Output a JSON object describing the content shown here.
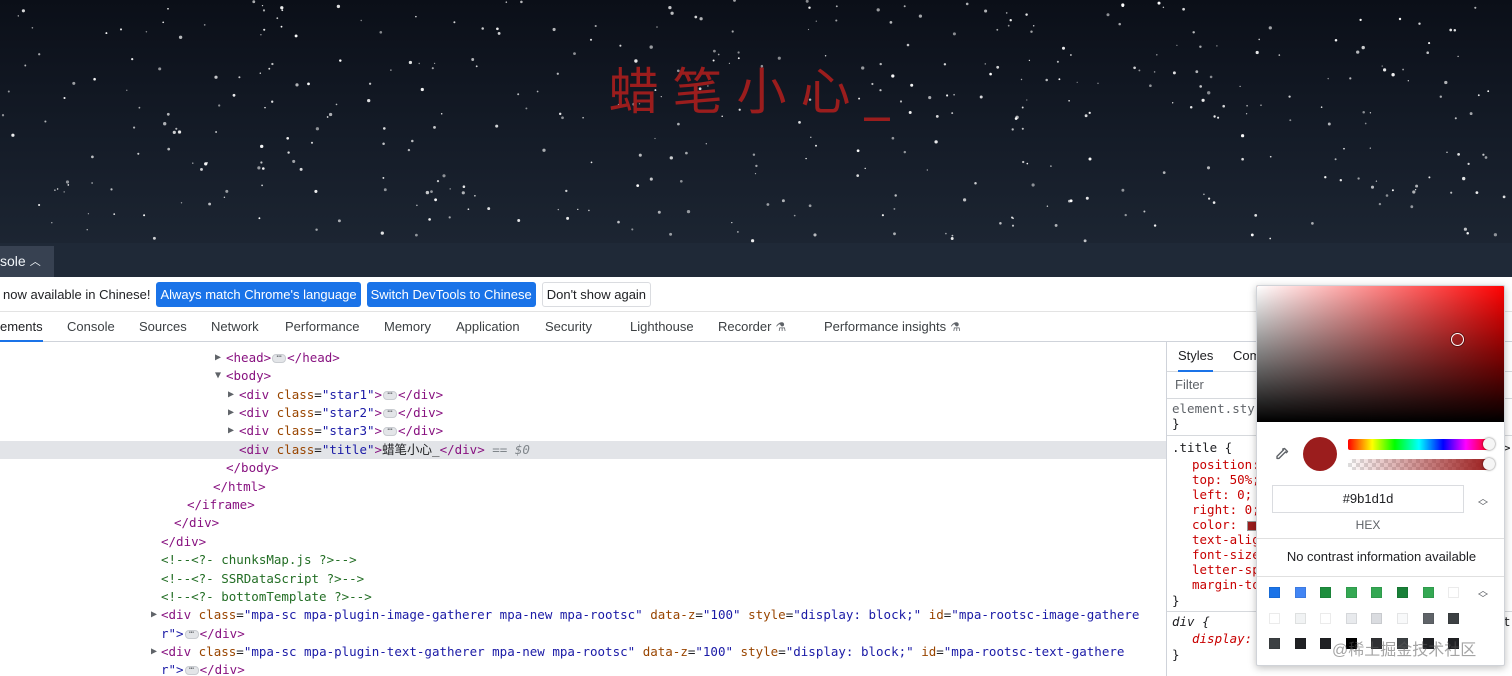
{
  "preview": {
    "title": "蜡笔小心_",
    "title_color": "#9b1d1d"
  },
  "drawer": {
    "tab_label": "sole"
  },
  "infobar": {
    "message": "now available in Chinese!",
    "btn_match": "Always match Chrome's language",
    "btn_switch": "Switch DevTools to Chinese",
    "btn_dismiss": "Don't show again"
  },
  "tabs": [
    "ements",
    "Console",
    "Sources",
    "Network",
    "Performance",
    "Memory",
    "Application",
    "Security",
    "Lighthouse",
    "Recorder",
    "Performance insights"
  ],
  "dom": {
    "head": [
      "<head>",
      "</head>"
    ],
    "body_open": "<body>",
    "div": "div",
    "class": "class",
    "star1": "\"star1\"",
    "star2": "\"star2\"",
    "star3": "\"star3\"",
    "title_cls": "\"title\"",
    "title_text": "蜡笔小心_",
    "close_div": "</div>",
    "eq_dollar": "== $0",
    "body_close": "</body>",
    "html_close": "</html>",
    "iframe_close": "</iframe>",
    "comment1": "<!--<?- chunksMap.js ?>-->",
    "comment2": "<!--<?- SSRDataScript ?>-->",
    "comment3": "<!--<?- bottomTemplate ?>-->",
    "mpa1_class": "\"mpa-sc mpa-plugin-image-gatherer mpa-new mpa-rootsc\"",
    "mpa1_id": "\"mpa-rootsc-image-gathere",
    "mpa2_class": "\"mpa-sc mpa-plugin-text-gatherer mpa-new mpa-rootsc\"",
    "mpa2_id": "\"mpa-rootsc-text-gathere",
    "data_z": "data-z",
    "data_z_val": "\"100\"",
    "style": "style",
    "style_val": "\"display: block;\"",
    "id": "id",
    "wrap_r": "r\">"
  },
  "styles": {
    "tab_styles": "Styles",
    "tab_computed": "Com",
    "filter": "Filter",
    "element_style": "element.sty",
    "brace_close": "}",
    "title_selector": ".title {",
    "props": [
      "position:",
      "top: 50%;",
      "left: 0;",
      "right: 0;",
      "color:",
      "text-alig",
      "font-size",
      "letter-sp",
      "margin-to"
    ],
    "div_selector": "div {",
    "div_prop": "display:",
    "t_char": "t"
  },
  "picker": {
    "hex_value": "#9b1d1d",
    "format_label": "HEX",
    "contrast_text": "No contrast information available",
    "palette": [
      "#1a73e8",
      "#4285f4",
      "#1e8e3e",
      "#34a853",
      "#34a853",
      "#188038",
      "#34a853",
      "#ffffff",
      "#ffffff",
      "#f1f3f4",
      "#ffffff",
      "#e8eaed",
      "#dadce0",
      "#f8f9fa",
      "#5f6368",
      "#3c4043",
      "#3c4043",
      "#202124",
      "#202124",
      "#000000",
      "#303134",
      "#3c4043",
      "#202124",
      "#202124"
    ]
  },
  "watermark": "@稀土掘金技术社区"
}
